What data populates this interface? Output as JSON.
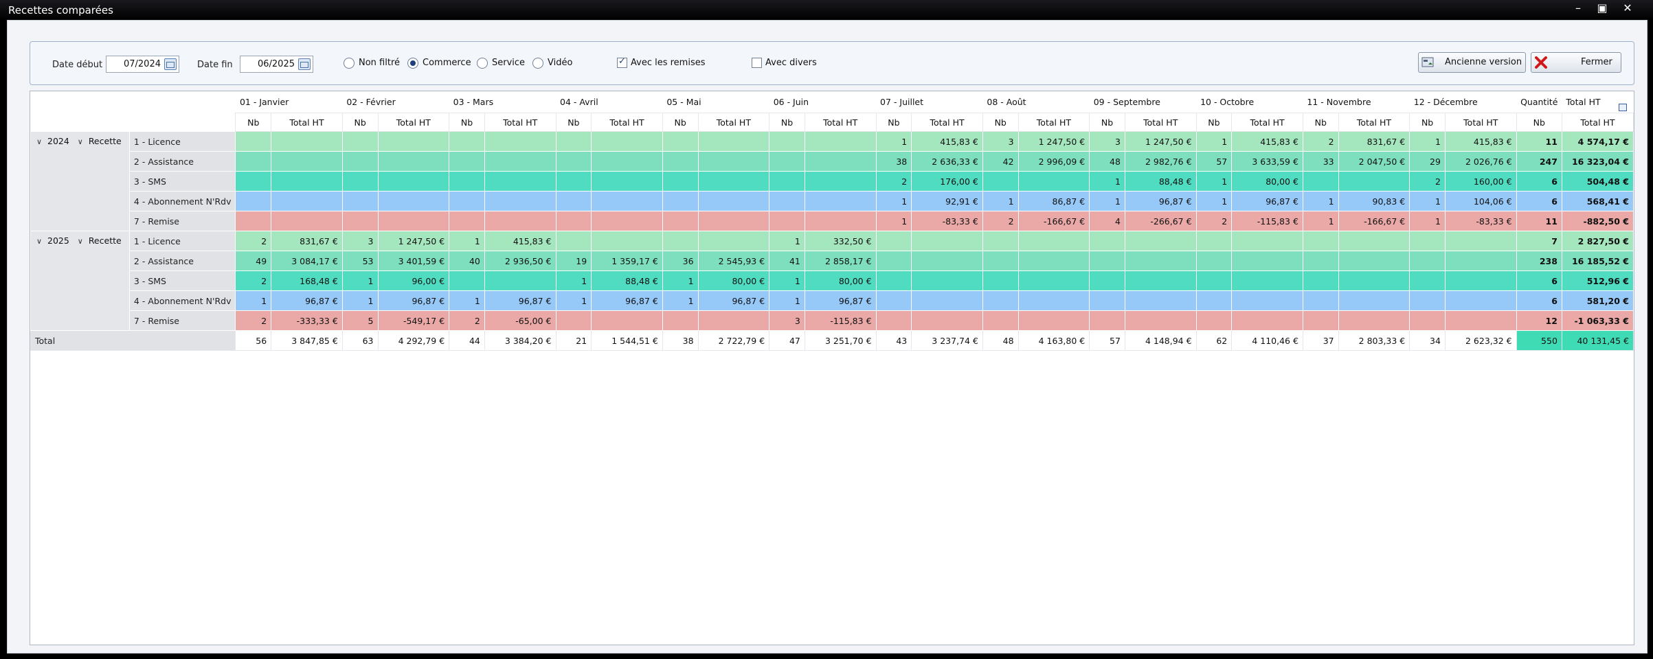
{
  "window": {
    "title": "Recettes comparées"
  },
  "filters": {
    "date_debut_label": "Date début",
    "date_debut_value": "07/2024",
    "date_fin_label": "Date fin",
    "date_fin_value": "06/2025",
    "radios": [
      {
        "label": "Non filtré",
        "selected": false
      },
      {
        "label": "Commerce",
        "selected": true
      },
      {
        "label": "Service",
        "selected": false
      },
      {
        "label": "Vidéo",
        "selected": false
      }
    ],
    "avec_remises": {
      "label": "Avec les remises",
      "checked": true
    },
    "avec_divers": {
      "label": "Avec divers",
      "checked": false
    },
    "ancienne_version_label": "Ancienne version",
    "fermer_label": "Fermer"
  },
  "grid": {
    "months": [
      "01 - Janvier",
      "02 - Février",
      "03 - Mars",
      "04 - Avril",
      "05 - Mai",
      "06 - Juin",
      "07 - Juillet",
      "08 - Août",
      "09 - Septembre",
      "10 - Octobre",
      "11 - Novembre",
      "12 - Décembre"
    ],
    "quantite_label": "Quantité",
    "total_ht_label": "Total HT",
    "nb_label": "Nb",
    "recette_label": "Recette",
    "total_label": "Total",
    "years": [
      {
        "year": "2024",
        "rows": [
          {
            "cls": "licence",
            "label": "1 - Licence",
            "cells": [
              [
                "",
                ""
              ],
              [
                "",
                ""
              ],
              [
                "",
                ""
              ],
              [
                "",
                ""
              ],
              [
                "",
                ""
              ],
              [
                "",
                ""
              ],
              [
                "1",
                "415,83 €"
              ],
              [
                "3",
                "1 247,50 €"
              ],
              [
                "3",
                "1 247,50 €"
              ],
              [
                "1",
                "415,83 €"
              ],
              [
                "2",
                "831,67 €"
              ],
              [
                "1",
                "415,83 €"
              ]
            ],
            "nb": "11",
            "total": "4 574,17 €"
          },
          {
            "cls": "assist",
            "label": "2 - Assistance",
            "cells": [
              [
                "",
                ""
              ],
              [
                "",
                ""
              ],
              [
                "",
                ""
              ],
              [
                "",
                ""
              ],
              [
                "",
                ""
              ],
              [
                "",
                ""
              ],
              [
                "38",
                "2 636,33 €"
              ],
              [
                "42",
                "2 996,09 €"
              ],
              [
                "48",
                "2 982,76 €"
              ],
              [
                "57",
                "3 633,59 €"
              ],
              [
                "33",
                "2 047,50 €"
              ],
              [
                "29",
                "2 026,76 €"
              ]
            ],
            "nb": "247",
            "total": "16 323,04 €"
          },
          {
            "cls": "sms",
            "label": "3 - SMS",
            "cells": [
              [
                "",
                ""
              ],
              [
                "",
                ""
              ],
              [
                "",
                ""
              ],
              [
                "",
                ""
              ],
              [
                "",
                ""
              ],
              [
                "",
                ""
              ],
              [
                "2",
                "176,00 €"
              ],
              [
                "",
                ""
              ],
              [
                "1",
                "88,48 €"
              ],
              [
                "1",
                "80,00 €"
              ],
              [
                "",
                ""
              ],
              [
                "2",
                "160,00 €"
              ]
            ],
            "nb": "6",
            "total": "504,48 €"
          },
          {
            "cls": "abo",
            "label": "4 - Abonnement N'Rdv",
            "cells": [
              [
                "",
                ""
              ],
              [
                "",
                ""
              ],
              [
                "",
                ""
              ],
              [
                "",
                ""
              ],
              [
                "",
                ""
              ],
              [
                "",
                ""
              ],
              [
                "1",
                "92,91 €"
              ],
              [
                "1",
                "86,87 €"
              ],
              [
                "1",
                "96,87 €"
              ],
              [
                "1",
                "96,87 €"
              ],
              [
                "1",
                "90,83 €"
              ],
              [
                "1",
                "104,06 €"
              ]
            ],
            "nb": "6",
            "total": "568,41 €"
          },
          {
            "cls": "remise",
            "label": "7 - Remise",
            "cells": [
              [
                "",
                ""
              ],
              [
                "",
                ""
              ],
              [
                "",
                ""
              ],
              [
                "",
                ""
              ],
              [
                "",
                ""
              ],
              [
                "",
                ""
              ],
              [
                "1",
                "-83,33 €"
              ],
              [
                "2",
                "-166,67 €"
              ],
              [
                "4",
                "-266,67 €"
              ],
              [
                "2",
                "-115,83 €"
              ],
              [
                "1",
                "-166,67 €"
              ],
              [
                "1",
                "-83,33 €"
              ]
            ],
            "nb": "11",
            "total": "-882,50 €"
          }
        ]
      },
      {
        "year": "2025",
        "rows": [
          {
            "cls": "licence",
            "label": "1 - Licence",
            "cells": [
              [
                "2",
                "831,67 €"
              ],
              [
                "3",
                "1 247,50 €"
              ],
              [
                "1",
                "415,83 €"
              ],
              [
                "",
                ""
              ],
              [
                "",
                ""
              ],
              [
                "1",
                "332,50 €"
              ],
              [
                "",
                ""
              ],
              [
                "",
                ""
              ],
              [
                "",
                ""
              ],
              [
                "",
                ""
              ],
              [
                "",
                ""
              ],
              [
                "",
                ""
              ]
            ],
            "nb": "7",
            "total": "2 827,50 €"
          },
          {
            "cls": "assist",
            "label": "2 - Assistance",
            "cells": [
              [
                "49",
                "3 084,17 €"
              ],
              [
                "53",
                "3 401,59 €"
              ],
              [
                "40",
                "2 936,50 €"
              ],
              [
                "19",
                "1 359,17 €"
              ],
              [
                "36",
                "2 545,93 €"
              ],
              [
                "41",
                "2 858,17 €"
              ],
              [
                "",
                ""
              ],
              [
                "",
                ""
              ],
              [
                "",
                ""
              ],
              [
                "",
                ""
              ],
              [
                "",
                ""
              ],
              [
                "",
                ""
              ]
            ],
            "nb": "238",
            "total": "16 185,52 €"
          },
          {
            "cls": "sms",
            "label": "3 - SMS",
            "cells": [
              [
                "2",
                "168,48 €"
              ],
              [
                "1",
                "96,00 €"
              ],
              [
                "",
                ""
              ],
              [
                "1",
                "88,48 €"
              ],
              [
                "1",
                "80,00 €"
              ],
              [
                "1",
                "80,00 €"
              ],
              [
                "",
                ""
              ],
              [
                "",
                ""
              ],
              [
                "",
                ""
              ],
              [
                "",
                ""
              ],
              [
                "",
                ""
              ],
              [
                "",
                ""
              ]
            ],
            "nb": "6",
            "total": "512,96 €"
          },
          {
            "cls": "abo",
            "label": "4 - Abonnement N'Rdv",
            "cells": [
              [
                "1",
                "96,87 €"
              ],
              [
                "1",
                "96,87 €"
              ],
              [
                "1",
                "96,87 €"
              ],
              [
                "1",
                "96,87 €"
              ],
              [
                "1",
                "96,87 €"
              ],
              [
                "1",
                "96,87 €"
              ],
              [
                "",
                ""
              ],
              [
                "",
                ""
              ],
              [
                "",
                ""
              ],
              [
                "",
                ""
              ],
              [
                "",
                ""
              ],
              [
                "",
                ""
              ]
            ],
            "nb": "6",
            "total": "581,20 €"
          },
          {
            "cls": "remise",
            "label": "7 - Remise",
            "cells": [
              [
                "2",
                "-333,33 €"
              ],
              [
                "5",
                "-549,17 €"
              ],
              [
                "2",
                "-65,00 €"
              ],
              [
                "",
                ""
              ],
              [
                "",
                ""
              ],
              [
                "3",
                "-115,83 €"
              ],
              [
                "",
                ""
              ],
              [
                "",
                ""
              ],
              [
                "",
                ""
              ],
              [
                "",
                ""
              ],
              [
                "",
                ""
              ],
              [
                "",
                ""
              ]
            ],
            "nb": "12",
            "total": "-1 063,33 €"
          }
        ]
      }
    ],
    "totals": {
      "cells": [
        [
          "56",
          "3 847,85 €"
        ],
        [
          "63",
          "4 292,79 €"
        ],
        [
          "44",
          "3 384,20 €"
        ],
        [
          "21",
          "1 544,51 €"
        ],
        [
          "38",
          "2 722,79 €"
        ],
        [
          "47",
          "3 251,70 €"
        ],
        [
          "43",
          "3 237,74 €"
        ],
        [
          "48",
          "4 163,80 €"
        ],
        [
          "57",
          "4 148,94 €"
        ],
        [
          "62",
          "4 110,46 €"
        ],
        [
          "37",
          "2 803,33 €"
        ],
        [
          "34",
          "2 623,32 €"
        ]
      ],
      "nb": "550",
      "total": "40 131,45 €"
    }
  }
}
